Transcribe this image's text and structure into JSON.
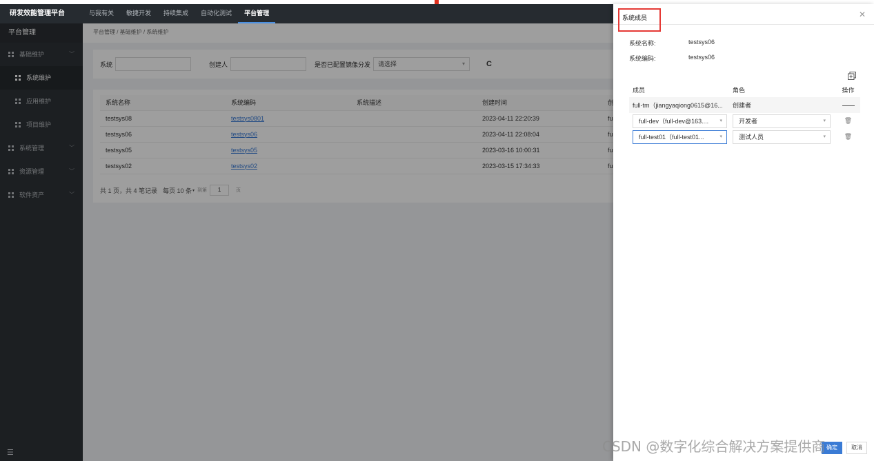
{
  "header": {
    "brand": "研发效能管理平台",
    "nav": [
      "与我有关",
      "敏捷开发",
      "持续集成",
      "自动化测试",
      "平台管理"
    ],
    "active_nav": "平台管理"
  },
  "sidebar": {
    "title": "平台管理",
    "items": [
      {
        "label": "基础维护",
        "chevron": "﹀"
      },
      {
        "label": "系统维护"
      },
      {
        "label": "应用维护"
      },
      {
        "label": "项目维护"
      },
      {
        "label": "系统管理",
        "chevron": "﹀"
      },
      {
        "label": "资源管理",
        "chevron": "﹀"
      },
      {
        "label": "软件资产",
        "chevron": "﹀"
      }
    ],
    "collapse_icon": "☰"
  },
  "breadcrumb": "平台管理 / 基础维护 / 系统维护",
  "filters": {
    "system_label": "系统",
    "system_value": "",
    "creator_label": "创建人",
    "creator_value": "",
    "mirror_label": "是否已配置镜像分发",
    "mirror_placeholder": "请选择",
    "refresh_icon": "C"
  },
  "table": {
    "headers": [
      "系统名称",
      "系统编码",
      "系统描述",
      "创建时间",
      "创"
    ],
    "rows": [
      {
        "name": "testsys08",
        "code": "testsys0801",
        "desc": "",
        "time": "2023-04-11 22:20:39",
        "extra": "fu"
      },
      {
        "name": "testsys06",
        "code": "testsys06",
        "desc": "",
        "time": "2023-04-11 22:08:04",
        "extra": "fu"
      },
      {
        "name": "testsys05",
        "code": "testsys05",
        "desc": "",
        "time": "2023-03-16 10:00:31",
        "extra": "fu"
      },
      {
        "name": "testsys02",
        "code": "testsys02",
        "desc": "",
        "time": "2023-03-15 17:34:33",
        "extra": "fu"
      }
    ]
  },
  "pager": {
    "summary": "共 1 页，共 4 笔记录",
    "per_page": "每页 10 条",
    "goto": "到第",
    "page": "1",
    "page_suffix": "页"
  },
  "drawer": {
    "title": "系统成员",
    "close_icon": "✕",
    "system_name_label": "系统名称:",
    "system_name": "testsys06",
    "system_code_label": "系统编码:",
    "system_code": "testsys06",
    "columns": [
      "成员",
      "角色",
      "操作"
    ],
    "members": [
      {
        "member": "full-tm（jiangyaqiong0615@16...",
        "role": "创建者"
      },
      {
        "member": "full-dev（full-dev@163....",
        "role": "开发者"
      },
      {
        "member": "full-test01（full-test01...",
        "role": "测试人员"
      }
    ],
    "ok_label": "确定",
    "cancel_label": "取消"
  },
  "watermark": "CSDN @数字化综合解决方案提供商"
}
